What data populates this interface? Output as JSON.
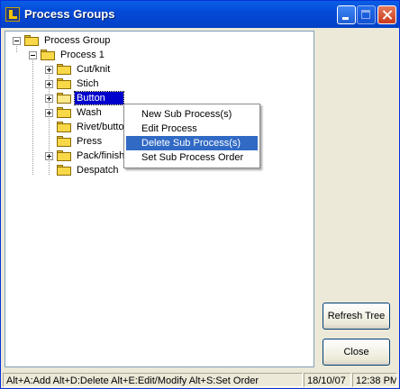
{
  "window": {
    "title": "Process Groups"
  },
  "tree": {
    "root": {
      "label": "Process Group",
      "expander": "minus"
    },
    "process": {
      "label": "Process 1",
      "expander": "minus"
    },
    "children": [
      {
        "label": "Cut/knit",
        "expander": "plus"
      },
      {
        "label": "Stich",
        "expander": "plus"
      },
      {
        "label": "Button",
        "expander": "plus",
        "selected": true
      },
      {
        "label": "Wash",
        "expander": "plus"
      },
      {
        "label": "Rivet/butto",
        "expander": ""
      },
      {
        "label": "Press",
        "expander": ""
      },
      {
        "label": "Pack/finish",
        "expander": "plus"
      },
      {
        "label": "Despatch",
        "expander": ""
      }
    ]
  },
  "context_menu": {
    "items": [
      {
        "label": "New Sub Process(s)"
      },
      {
        "label": "Edit Process"
      },
      {
        "label": "Delete Sub Process(s)",
        "highlighted": true
      },
      {
        "label": "Set Sub Process Order"
      }
    ]
  },
  "buttons": {
    "refresh": "Refresh Tree",
    "close": "Close"
  },
  "status": {
    "hints": "Alt+A:Add   Alt+D:Delete   Alt+E:Edit/Modify   Alt+S:Set Order",
    "date": "18/10/07",
    "time": "12:38 PM"
  },
  "colors": {
    "selection": "#0000cc",
    "menu_highlight": "#316ac5",
    "titlebar": "#0449d8"
  }
}
